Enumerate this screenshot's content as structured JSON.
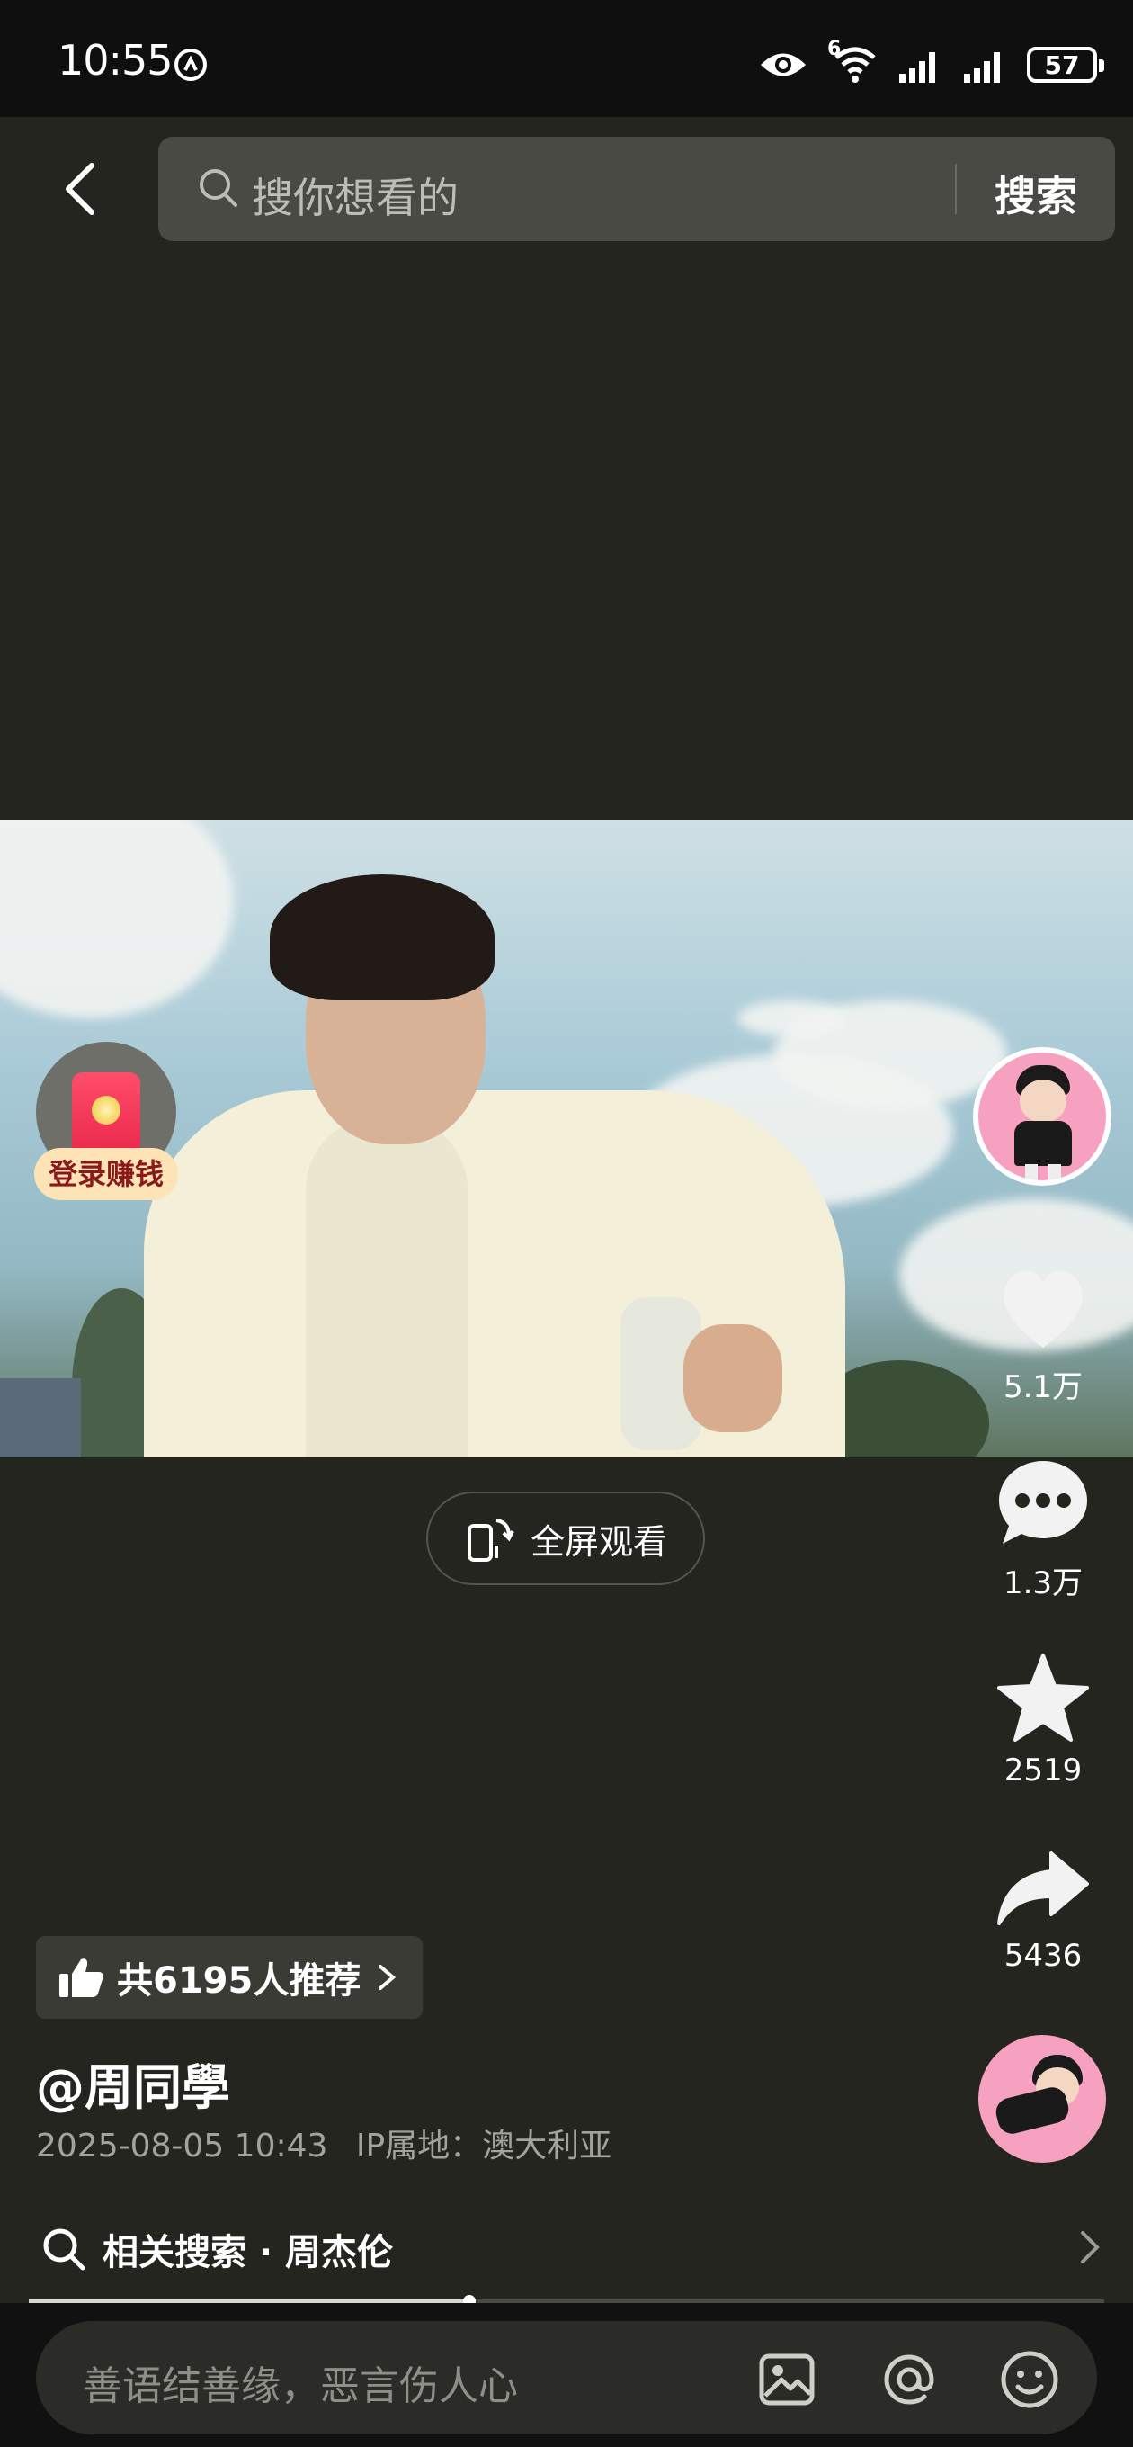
{
  "status_bar": {
    "time": "10:55",
    "network": "6",
    "battery": "57"
  },
  "search": {
    "placeholder": "搜你想看的",
    "submit_label": "搜索"
  },
  "red_packet": {
    "label": "登录赚钱"
  },
  "actions": {
    "likes": "5.1万",
    "comments": "1.3万",
    "favorites": "2519",
    "shares": "5436"
  },
  "fullscreen_label": "全屏观看",
  "recommend": {
    "text": "共6195人推荐"
  },
  "post": {
    "author": "@周同學",
    "date": "2025-08-05 10:43",
    "ip_location": "IP属地：澳大利亚"
  },
  "related_search": {
    "text": "相关搜索 · 周杰伦"
  },
  "playback": {
    "progress": 0.41
  },
  "comment": {
    "placeholder": "善语结善缘，恶言伤人心"
  },
  "colors": {
    "background": "#25251f",
    "avatar_pink": "#f7a1c0",
    "red_packet": "#e8254a"
  }
}
